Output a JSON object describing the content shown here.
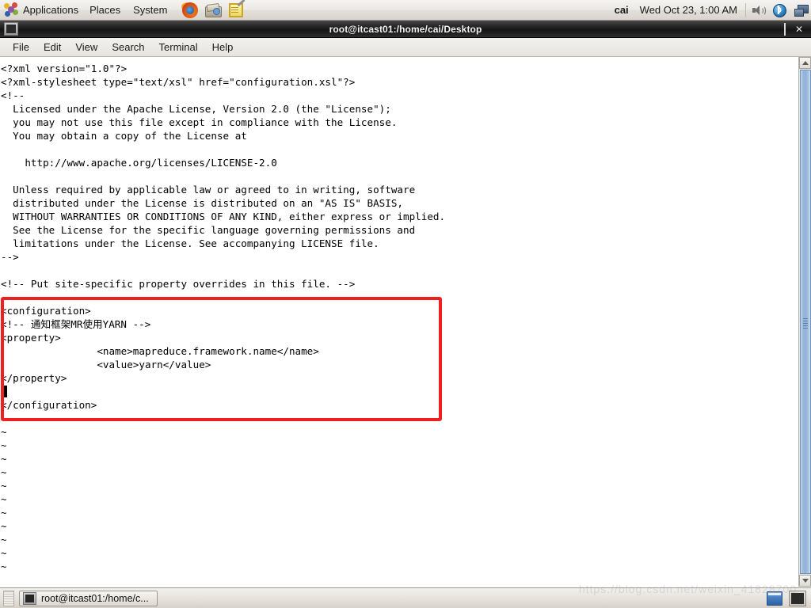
{
  "top_panel": {
    "applications_label": "Applications",
    "places_label": "Places",
    "system_label": "System",
    "launchers": [
      {
        "name": "firefox-launcher",
        "label": "Firefox"
      },
      {
        "name": "file-manager-launcher",
        "label": "File Manager"
      },
      {
        "name": "text-editor-launcher",
        "label": "Text Editor"
      }
    ],
    "user": "cai",
    "clock": "Wed Oct 23,  1:00 AM",
    "tray": [
      {
        "name": "volume-icon",
        "label": "Volume"
      },
      {
        "name": "bluetooth-icon",
        "label": "Bluetooth"
      },
      {
        "name": "network-icon",
        "label": "Network"
      }
    ]
  },
  "window": {
    "title": "root@itcast01:/home/cai/Desktop",
    "minimize_label": "_",
    "maximize_label": "□",
    "close_label": "✕",
    "menus": [
      "File",
      "Edit",
      "View",
      "Search",
      "Terminal",
      "Help"
    ]
  },
  "terminal": {
    "lines": [
      "<?xml version=\"1.0\"?>",
      "<?xml-stylesheet type=\"text/xsl\" href=\"configuration.xsl\"?>",
      "<!--",
      "  Licensed under the Apache License, Version 2.0 (the \"License\");",
      "  you may not use this file except in compliance with the License.",
      "  You may obtain a copy of the License at",
      "",
      "    http://www.apache.org/licenses/LICENSE-2.0",
      "",
      "  Unless required by applicable law or agreed to in writing, software",
      "  distributed under the License is distributed on an \"AS IS\" BASIS,",
      "  WITHOUT WARRANTIES OR CONDITIONS OF ANY KIND, either express or implied.",
      "  See the License for the specific language governing permissions and",
      "  limitations under the License. See accompanying LICENSE file.",
      "-->",
      "",
      "<!-- Put site-specific property overrides in this file. -->",
      "",
      "<configuration>",
      "<!-- 通知框架MR使用YARN -->",
      "<property>",
      "                <name>mapreduce.framework.name</name>",
      "                <value>yarn</value>",
      "</property>",
      "",
      "</configuration>",
      "~"
    ],
    "tilde_lines": [
      "~",
      "~",
      "~",
      "~",
      "~",
      "~",
      "~",
      "~",
      "~",
      "~",
      "~"
    ],
    "cursor": {
      "line": 24,
      "column": 0
    },
    "annotation": {
      "name": "red-highlight-box",
      "color": "#ee2020"
    }
  },
  "taskbar": {
    "task_button_label": "root@itcast01:/home/c...",
    "tray": [
      {
        "name": "folder-tray-icon",
        "label": "Files"
      },
      {
        "name": "terminal-tray-icon",
        "label": "Terminal"
      }
    ]
  },
  "watermark": {
    "text": "https://blog.csdn.net/weixin_41828700"
  }
}
